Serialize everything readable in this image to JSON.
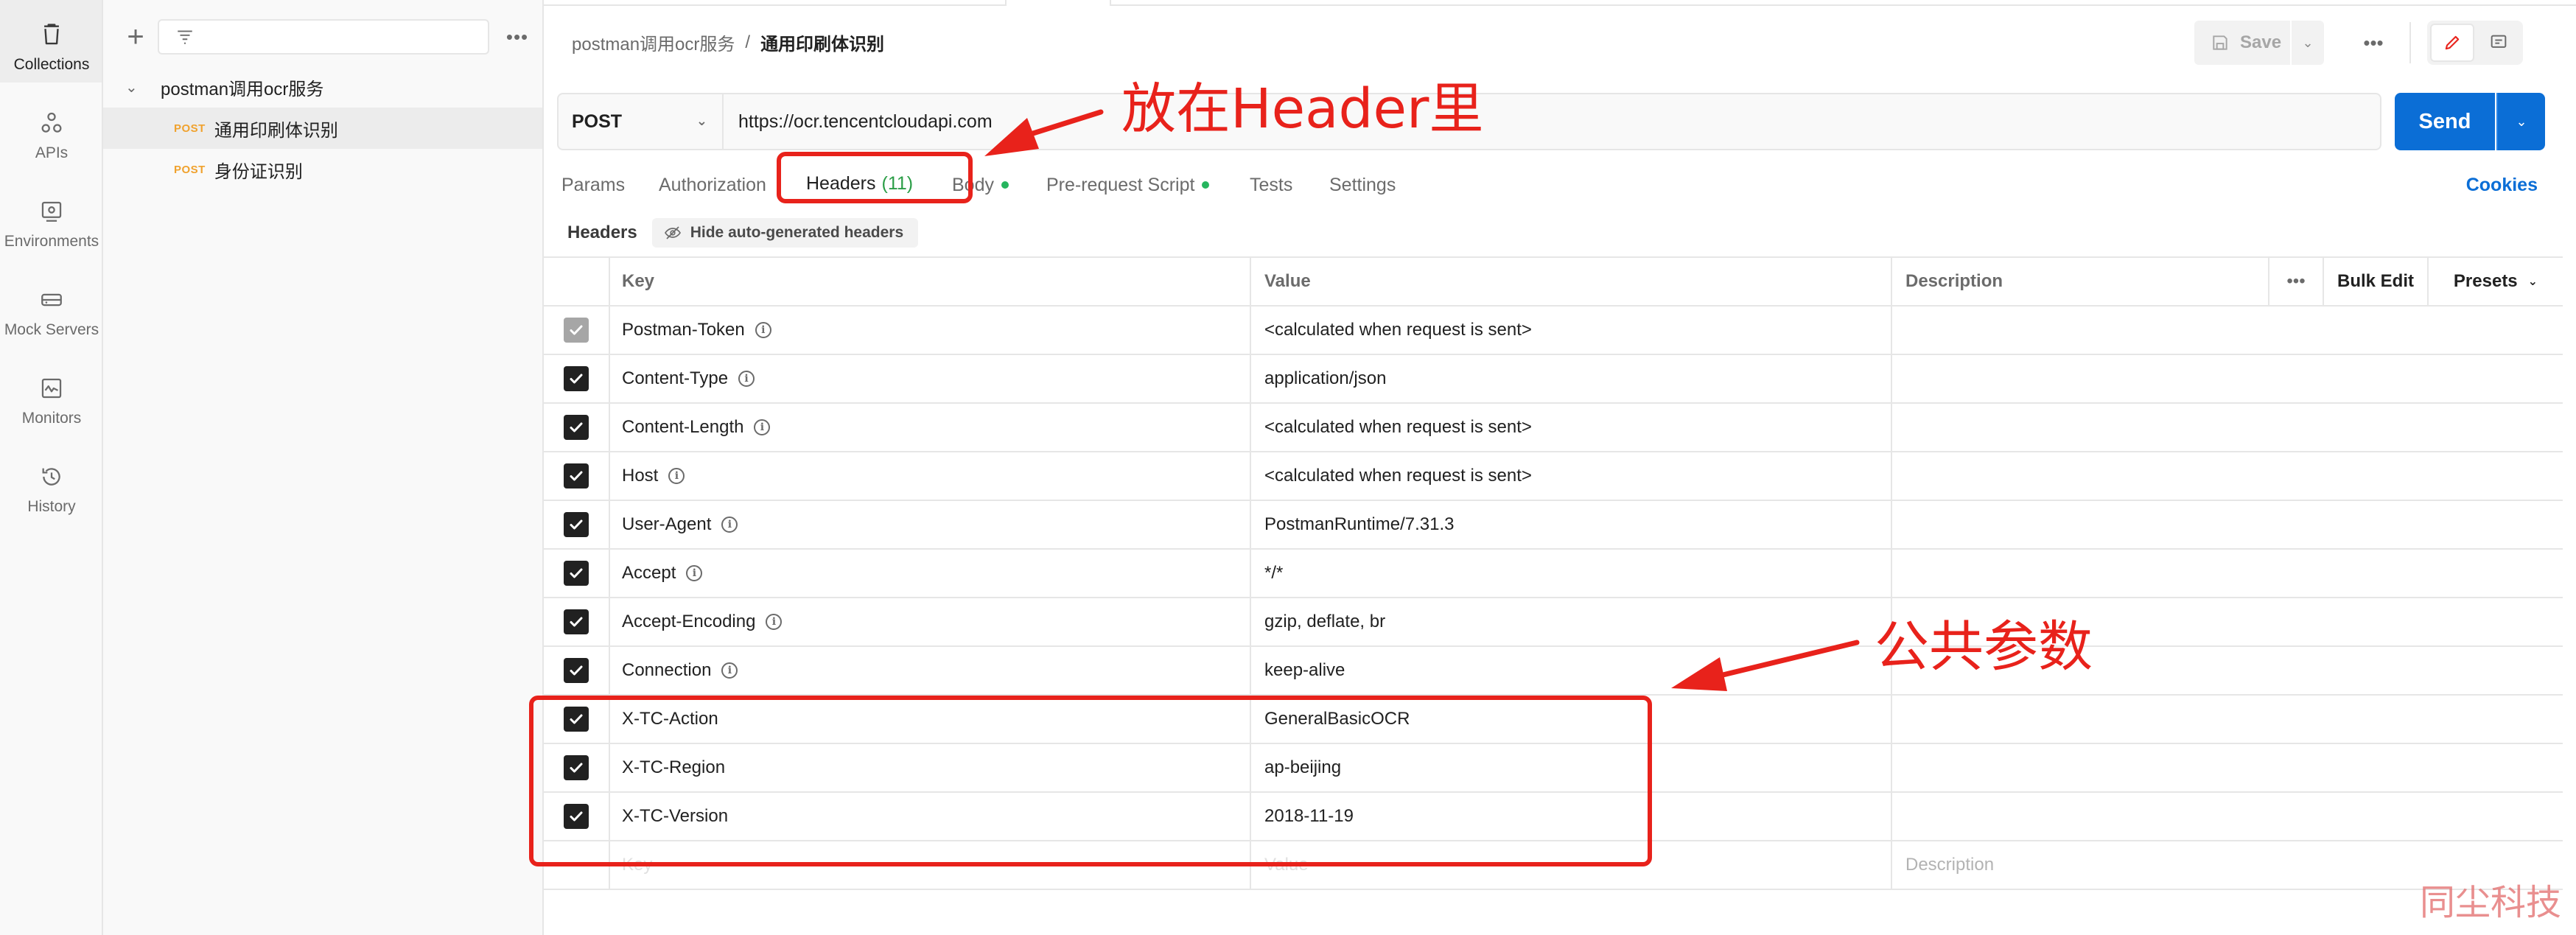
{
  "rail": [
    {
      "label": "Collections",
      "icon": "trash-can-icon"
    },
    {
      "label": "APIs",
      "icon": "api-nodes-icon"
    },
    {
      "label": "Environments",
      "icon": "environment-icon"
    },
    {
      "label": "Mock Servers",
      "icon": "mock-server-icon"
    },
    {
      "label": "Monitors",
      "icon": "monitor-icon"
    },
    {
      "label": "History",
      "icon": "history-icon"
    }
  ],
  "sidebar": {
    "collection_name": "postman调用ocr服务",
    "requests": [
      {
        "method": "POST",
        "name": "通用印刷体识别"
      },
      {
        "method": "POST",
        "name": "身份证识别"
      }
    ]
  },
  "header": {
    "breadcrumb_parent": "postman调用ocr服务",
    "breadcrumb_sep": "/",
    "breadcrumb_current": "通用印刷体识别",
    "save_label": "Save"
  },
  "request": {
    "method": "POST",
    "url": "https://ocr.tencentcloudapi.com",
    "send_label": "Send"
  },
  "tabs": [
    {
      "label": "Params"
    },
    {
      "label": "Authorization"
    },
    {
      "label": "Headers",
      "count": "(11)"
    },
    {
      "label": "Body"
    },
    {
      "label": "Pre-request Script"
    },
    {
      "label": "Tests"
    },
    {
      "label": "Settings"
    }
  ],
  "cookies_label": "Cookies",
  "headers_section": {
    "title": "Headers",
    "toggle_label": "Hide auto-generated headers"
  },
  "table": {
    "columns": {
      "key": "Key",
      "value": "Value",
      "description": "Description"
    },
    "more": "•••",
    "bulk_edit": "Bulk Edit",
    "presets": "Presets",
    "rows": [
      {
        "key": "Postman-Token",
        "value": "<calculated when request is sent>"
      },
      {
        "key": "Content-Type",
        "value": "application/json"
      },
      {
        "key": "Content-Length",
        "value": "<calculated when request is sent>"
      },
      {
        "key": "Host",
        "value": "<calculated when request is sent>"
      },
      {
        "key": "User-Agent",
        "value": "PostmanRuntime/7.31.3"
      },
      {
        "key": "Accept",
        "value": "*/*"
      },
      {
        "key": "Accept-Encoding",
        "value": "gzip, deflate, br"
      },
      {
        "key": "Connection",
        "value": "keep-alive"
      },
      {
        "key": "X-TC-Action",
        "value": "GeneralBasicOCR"
      },
      {
        "key": "X-TC-Region",
        "value": "ap-beijing"
      },
      {
        "key": "X-TC-Version",
        "value": "2018-11-19"
      }
    ],
    "placeholder": {
      "key": "Key",
      "value": "Value",
      "description": "Description"
    }
  },
  "annotations": {
    "header_note": "放在Header里",
    "params_note": "公共参数",
    "color": "#e8221b"
  },
  "watermark": "同尘科技",
  "colors": {
    "accent": "#0b6ed6",
    "active_tab": "#f26b3a",
    "method_post": "#f0a22e",
    "green_dot": "#26b55e"
  }
}
